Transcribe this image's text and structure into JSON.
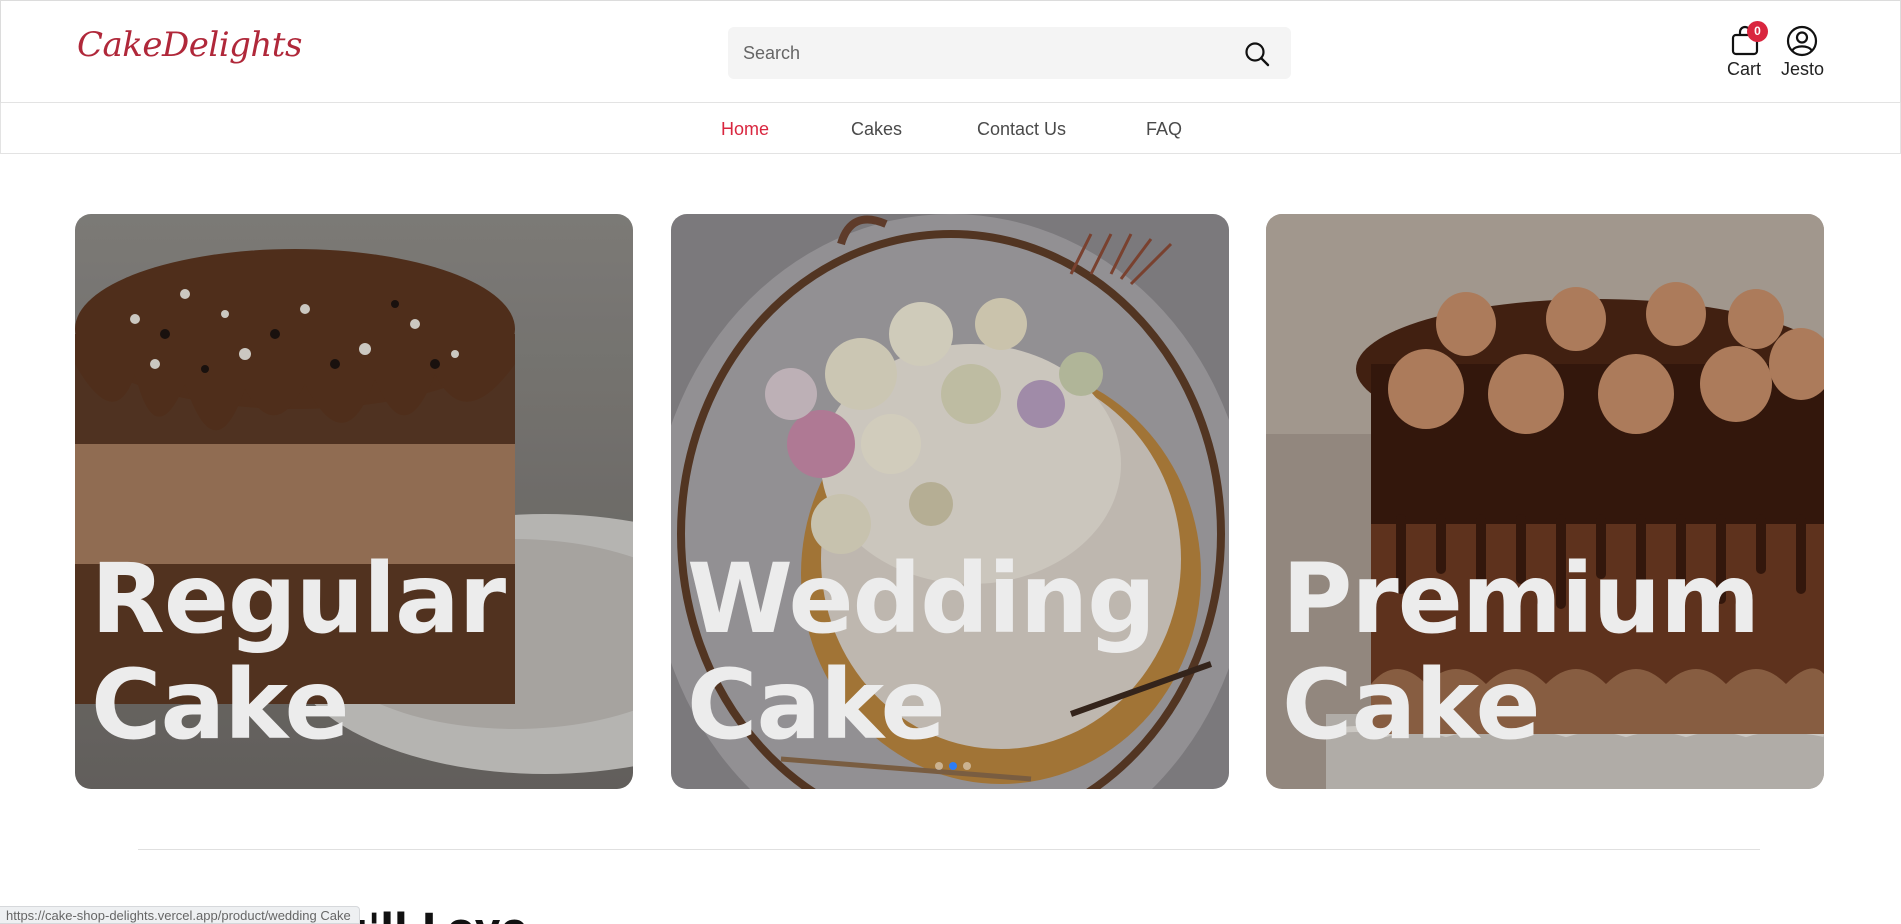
{
  "header": {
    "logo_text": "CakeDelights",
    "search": {
      "placeholder": "Search",
      "value": ""
    },
    "cart": {
      "label": "Cart",
      "count": "0"
    },
    "user": {
      "label": "Jesto"
    }
  },
  "nav": {
    "items": [
      {
        "label": "Home",
        "active": true
      },
      {
        "label": "Cakes",
        "active": false
      },
      {
        "label": "Contact Us",
        "active": false
      },
      {
        "label": "FAQ",
        "active": false
      }
    ]
  },
  "categories": [
    {
      "line1": "Regular",
      "line2": "Cake"
    },
    {
      "line1": "Wedding",
      "line2": "Cake"
    },
    {
      "line1": "Premium",
      "line2": "Cake"
    }
  ],
  "carousel": {
    "active_dot": 1,
    "dot_count": 3
  },
  "section": {
    "heading": "Cakes You'll Love"
  },
  "status_bar": {
    "url": "https://cake-shop-delights.vercel.app/product/wedding Cake"
  },
  "colors": {
    "accent": "#d9263f",
    "logo": "#b0283a",
    "dot_active": "#2d7df6"
  },
  "icons": {
    "search": "search-icon",
    "cart": "bag-icon",
    "user": "user-circle-icon"
  }
}
